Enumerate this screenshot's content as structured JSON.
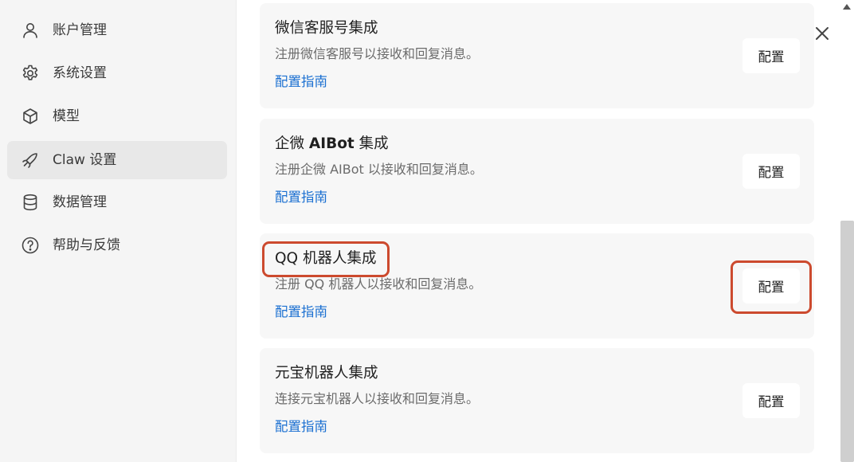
{
  "sidebar": {
    "items": [
      {
        "label": "账户管理",
        "icon": "user-icon"
      },
      {
        "label": "系统设置",
        "icon": "gear-icon"
      },
      {
        "label": "模型",
        "icon": "cube-icon"
      },
      {
        "label": "Claw 设置",
        "icon": "claw-icon",
        "active": true
      },
      {
        "label": "数据管理",
        "icon": "database-icon"
      },
      {
        "label": "帮助与反馈",
        "icon": "help-icon"
      }
    ]
  },
  "cards": [
    {
      "title": "微信客服号集成",
      "description": "注册微信客服号以接收和回复消息。",
      "link": "配置指南",
      "button": "配置"
    },
    {
      "title_prefix": "企微 ",
      "title_bold": "AIBot",
      "title_suffix": " 集成",
      "description": "注册企微 AIBot 以接收和回复消息。",
      "link": "配置指南",
      "button": "配置"
    },
    {
      "title": "QQ 机器人集成",
      "description": "注册 QQ 机器人以接收和回复消息。",
      "link": "配置指南",
      "button": "配置",
      "highlighted": true
    },
    {
      "title": "元宝机器人集成",
      "description": "连接元宝机器人以接收和回复消息。",
      "link": "配置指南",
      "button": "配置"
    }
  ],
  "colors": {
    "highlight": "#cc4a2e",
    "link": "#1a6fd1",
    "sidebar_bg": "#f5f5f5",
    "card_bg": "#f7f7f7"
  },
  "window": {
    "close_icon": "close-icon"
  }
}
